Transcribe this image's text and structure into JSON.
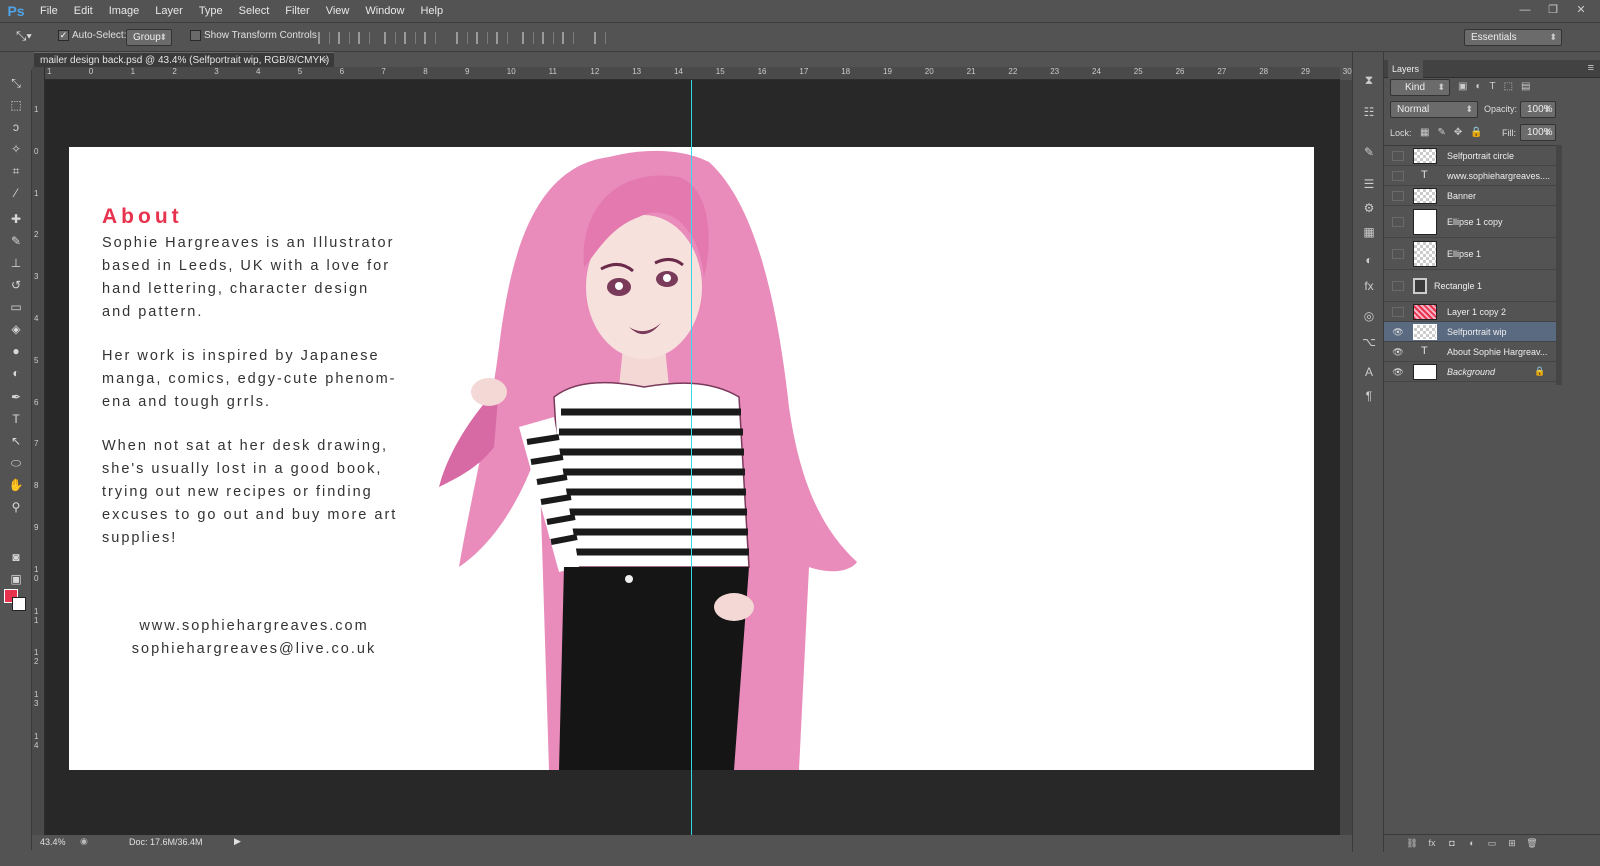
{
  "app": {
    "logo": "Ps"
  },
  "menu": [
    "File",
    "Edit",
    "Image",
    "Layer",
    "Type",
    "Select",
    "Filter",
    "View",
    "Window",
    "Help"
  ],
  "options": {
    "auto_select_label": "Auto-Select:",
    "auto_select_value": "Group",
    "show_transform_label": "Show Transform Controls",
    "workspace": "Essentials"
  },
  "document": {
    "tab_title": "mailer design back.psd @ 43.4% (Selfportrait wip, RGB/8/CMYK)",
    "close": "×"
  },
  "rulers": {
    "h": [
      "1",
      "0",
      "1",
      "2",
      "3",
      "4",
      "5",
      "6",
      "7",
      "8",
      "9",
      "10",
      "11",
      "12",
      "13",
      "14",
      "15",
      "16",
      "17",
      "18",
      "19",
      "20",
      "21",
      "22",
      "23",
      "24",
      "25",
      "26",
      "27",
      "28",
      "29",
      "30"
    ],
    "v": [
      "1",
      "0",
      "1",
      "2",
      "3",
      "4",
      "5",
      "6",
      "7",
      "8",
      "9",
      "1 0",
      "1 1",
      "1 2",
      "1 3",
      "1 4"
    ]
  },
  "artboard": {
    "about_title": "About",
    "para1": [
      "Sophie Hargreaves is an Illustrator",
      "based in Leeds, UK with a love for",
      "hand lettering, character design",
      "and pattern."
    ],
    "para2": [
      "Her work is inspired by Japanese",
      "manga, comics, edgy-cute phenom-",
      "ena and tough grrls."
    ],
    "para3": [
      "When not sat at her desk drawing,",
      "she's usually lost in a good book,",
      "trying out new recipes or finding",
      "excuses to go out and buy more art",
      "supplies!"
    ],
    "website": "www.sophiehargreaves.com",
    "email": "sophiehargreaves@live.co.uk"
  },
  "status": {
    "zoom": "43.4%",
    "doc": "Doc: 17.6M/36.4M"
  },
  "layers_panel": {
    "tab": "Layers",
    "filter": "Kind",
    "blend_mode": "Normal",
    "opacity_label": "Opacity:",
    "opacity_value": "100%",
    "lock_label": "Lock:",
    "fill_label": "Fill:",
    "fill_value": "100%",
    "layers": [
      {
        "name": "Selfportrait circle",
        "visible": false,
        "kind": "smart"
      },
      {
        "name": "www.sophiehargreaves....",
        "visible": false,
        "kind": "text"
      },
      {
        "name": "Banner",
        "visible": false,
        "kind": "smart"
      },
      {
        "name": "Ellipse 1 copy",
        "visible": false,
        "kind": "shape"
      },
      {
        "name": "Ellipse 1",
        "visible": false,
        "kind": "shape-checker"
      },
      {
        "name": "Rectangle 1",
        "visible": false,
        "kind": "rect"
      },
      {
        "name": "Layer 1 copy 2",
        "visible": false,
        "kind": "pattern"
      },
      {
        "name": "Selfportrait wip",
        "visible": true,
        "kind": "smart",
        "selected": true
      },
      {
        "name": "About Sophie Hargreav...",
        "visible": true,
        "kind": "text"
      },
      {
        "name": "Background",
        "visible": true,
        "kind": "background"
      }
    ]
  },
  "colors": {
    "accent": "#e8334f",
    "guide": "#35d8e8",
    "hair": "#e67fb0",
    "selected_row": "#5a6a80"
  }
}
